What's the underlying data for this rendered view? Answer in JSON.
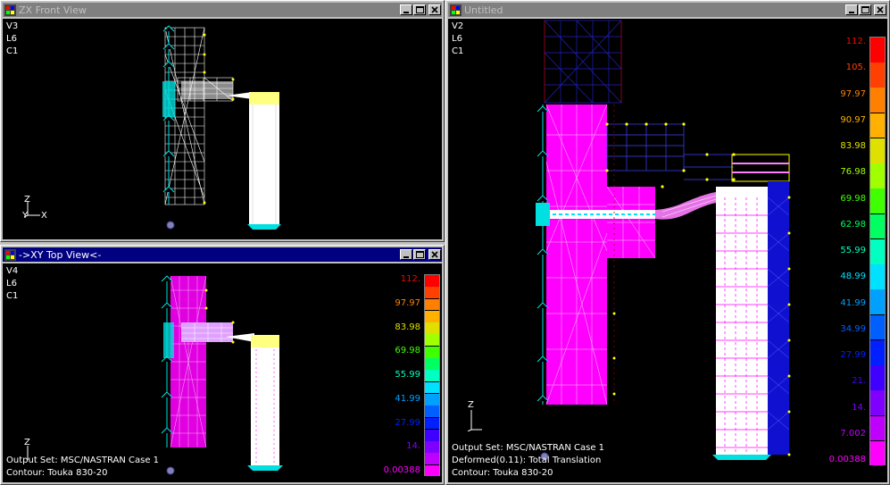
{
  "windows": {
    "zx": {
      "title": "ZX Front View",
      "info": [
        "V3",
        "L6",
        "C1"
      ],
      "triad": {
        "z": "Z",
        "y": "Y",
        "x": "X"
      }
    },
    "xy": {
      "title": "->XY Top View<-",
      "info": [
        "V4",
        "L6",
        "C1"
      ],
      "triad": {
        "z": "Z"
      },
      "output_lines": [
        "Output Set: MSC/NASTRAN Case 1",
        "Contour: Touka 830-20"
      ],
      "legend": [
        "112.",
        "97.97",
        "83.98",
        "69.98",
        "55.99",
        "41.99",
        "27.99",
        "14.",
        "0.00388"
      ]
    },
    "untitled": {
      "title": "Untitled",
      "info": [
        "V2",
        "L6",
        "C1"
      ],
      "triad": {
        "z": "Z"
      },
      "output_lines": [
        "Output Set: MSC/NASTRAN Case 1",
        "Deformed(0.11): Total Translation",
        "Contour: Touka 830-20"
      ],
      "legend": [
        "112.",
        "105.",
        "97.97",
        "90.97",
        "83.98",
        "76.98",
        "69.98",
        "62.98",
        "55.99",
        "48.99",
        "41.99",
        "34.99",
        "27.99",
        "21.",
        "14.",
        "7.002",
        "0.00388"
      ]
    }
  },
  "colors": {
    "scale": [
      "#ff0000",
      "#ff4000",
      "#ff8000",
      "#ffb000",
      "#e0e000",
      "#a0ff00",
      "#40ff00",
      "#00ff60",
      "#00ffc0",
      "#00e0ff",
      "#00a0ff",
      "#0060ff",
      "#0020ff",
      "#4000ff",
      "#8000ff",
      "#c000ff",
      "#ff00ff"
    ],
    "mesh_white": "#ffffff",
    "mesh_magenta": "#ff00ff",
    "mesh_blue": "#0000ff",
    "mesh_dark_blue": "#000080",
    "mesh_red": "#a00000",
    "constraint_cyan": "#00e0e0",
    "node_yellow": "#ffff00"
  },
  "icons": [
    "app-icon",
    "minimize-icon",
    "maximize-icon",
    "close-icon"
  ]
}
